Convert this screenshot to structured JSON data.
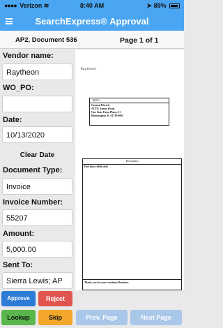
{
  "status_bar": {
    "carrier": "Verizon",
    "time": "8:40 AM",
    "battery": "85%"
  },
  "header": {
    "title": "SearchExpress® Approval"
  },
  "info": {
    "doc_id": "AP2, Document 536",
    "page": "Page 1 of 1"
  },
  "form": {
    "vendor": {
      "label": "Vendor name:",
      "value": "Raytheon"
    },
    "wo_po": {
      "label": "WO_PO:",
      "value": ""
    },
    "date": {
      "label": "Date:",
      "value": "10/13/2020"
    },
    "clear_date": "Clear Date",
    "doc_type": {
      "label": "Document Type:",
      "value": "Invoice"
    },
    "invoice_number": {
      "label": "Invoice Number:",
      "value": "55207"
    },
    "amount": {
      "label": "Amount:",
      "value": "5,000.00"
    },
    "sent_to": {
      "label": "Sent To:",
      "value": "Sierra Lewis; AP"
    }
  },
  "document": {
    "ocr_header": "Raytheon",
    "bill_to": {
      "heading": "Bill To",
      "lines": [
        "General Electric",
        "ATTN: James Wyatt",
        "One State Farm Plaza, A-1",
        "Bloomington, IL 61710-0001"
      ]
    },
    "table": {
      "heading": "Description",
      "row1": "Part four rolled steel",
      "footer": "Thank you for your continued business."
    }
  },
  "buttons": {
    "approve": "Approve",
    "reject": "Reject",
    "lookup": "Lookup",
    "skip": "Skip",
    "prev": "Prev. Page",
    "next": "Next Page"
  }
}
